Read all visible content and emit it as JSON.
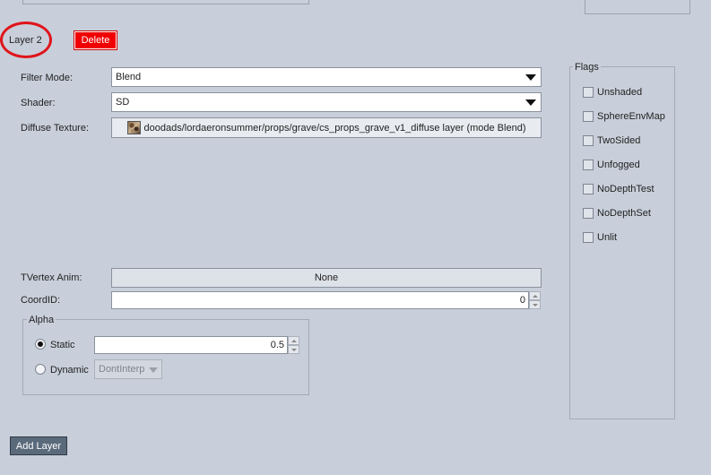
{
  "layer": {
    "title": "Layer 2",
    "delete_label": "Delete"
  },
  "fields": {
    "filter_mode_label": "Filter Mode:",
    "filter_mode_value": "Blend",
    "shader_label": "Shader:",
    "shader_value": "SD",
    "diffuse_label": "Diffuse Texture:",
    "diffuse_value": "doodads/lordaeronsummer/props/grave/cs_props_grave_v1_diffuse layer (mode Blend)",
    "tvertex_label": "TVertex Anim:",
    "tvertex_value": "None",
    "coord_label": "CoordID:",
    "coord_value": "0"
  },
  "alpha": {
    "title": "Alpha",
    "static_label": "Static",
    "static_selected": true,
    "static_value": "0.5",
    "dynamic_label": "Dynamic",
    "interp_value": "DontInterp"
  },
  "flags": {
    "title": "Flags",
    "items": [
      {
        "label": "Unshaded",
        "checked": false
      },
      {
        "label": "SphereEnvMap",
        "checked": false
      },
      {
        "label": "TwoSided",
        "checked": false
      },
      {
        "label": "Unfogged",
        "checked": false
      },
      {
        "label": "NoDepthTest",
        "checked": false
      },
      {
        "label": "NoDepthSet",
        "checked": false
      },
      {
        "label": "Unlit",
        "checked": false
      }
    ]
  },
  "footer": {
    "add_layer_label": "Add Layer"
  },
  "colors": {
    "background": "#c8cfda",
    "delete_button": "#f00000",
    "annotation_circle": "#e0141b",
    "add_layer_button": "#5b6a7b"
  }
}
